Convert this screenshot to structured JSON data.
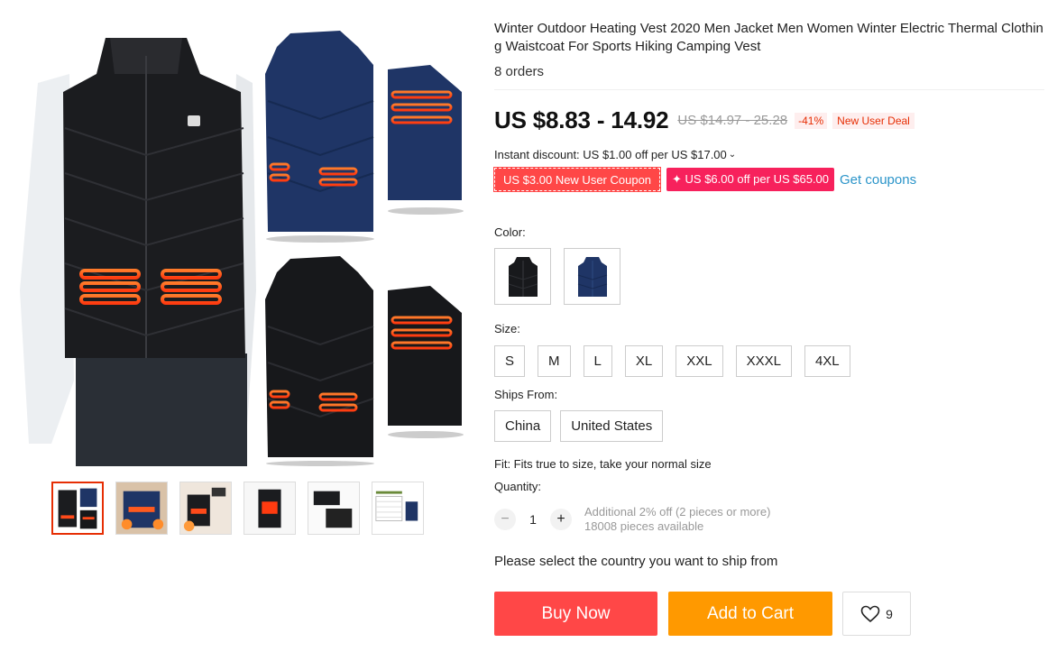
{
  "product": {
    "title": "Winter Outdoor Heating Vest 2020 Men Jacket Men Women Winter Electric Thermal Clothing Waistcoat For Sports Hiking Camping Vest",
    "orders": "8 orders"
  },
  "pricing": {
    "price": "US $8.83 - 14.92",
    "original_price": "US $14.97 - 25.28",
    "discount_percent": "-41%",
    "deal_tag": "New User Deal"
  },
  "discounts": {
    "instant_discount": "Instant discount: US $1.00 off per US $17.00",
    "coupon_new_user": "US $3.00 New User Coupon",
    "coupon_store": "✦ US $6.00 off per US $65.00",
    "get_coupons": "Get coupons"
  },
  "options": {
    "color_label": "Color:",
    "colors": [
      "black-vest",
      "navy-vest"
    ],
    "size_label": "Size:",
    "sizes": [
      "S",
      "M",
      "L",
      "XL",
      "XXL",
      "XXXL",
      "4XL"
    ],
    "ships_from_label": "Ships From:",
    "ships_from": [
      "China",
      "United States"
    ],
    "fit": "Fit: Fits true to size, take your normal size"
  },
  "quantity": {
    "label": "Quantity:",
    "value": "1",
    "minus": "−",
    "plus": "+",
    "additional_discount": "Additional 2% off (2 pieces or more)",
    "available": "18008 pieces available"
  },
  "shipping_message": "Please select the country you want to ship from",
  "actions": {
    "buy_now": "Buy Now",
    "add_to_cart": "Add to Cart",
    "wishlist_count": "9"
  },
  "gallery": {
    "thumbnails": [
      "thumb-1",
      "thumb-2",
      "thumb-3",
      "thumb-4",
      "thumb-5",
      "thumb-6"
    ],
    "active_index": 0
  },
  "colors": {
    "accent_red": "#ff4747",
    "cart_orange": "#ff9900",
    "link_blue": "#2a94c9",
    "coupon_pink": "#f7215c"
  }
}
